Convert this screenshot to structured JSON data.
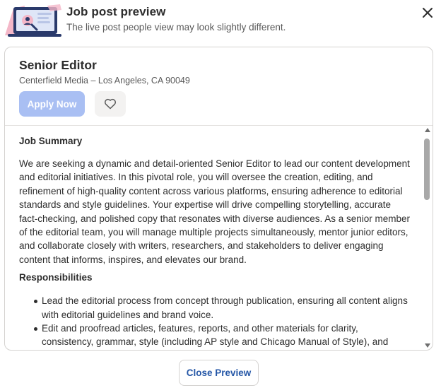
{
  "header": {
    "title": "Job post preview",
    "subtitle": "The live post people view may look slightly different."
  },
  "job": {
    "title": "Senior Editor",
    "company_location": "Centerfield Media – Los Angeles, CA 90049",
    "apply_label": "Apply Now"
  },
  "description": {
    "summary_heading": "Job Summary",
    "summary_text": "We are seeking a dynamic and detail-oriented Senior Editor to lead our content development and editorial initiatives. In this pivotal role, you will oversee the creation, editing, and refinement of high-quality content across various platforms, ensuring adherence to editorial standards and style guidelines. Your expertise will drive compelling storytelling, accurate fact-checking, and polished copy that resonates with diverse audiences. As a senior member of the editorial team, you will manage multiple projects simultaneously, mentor junior editors, and collaborate closely with writers, researchers, and stakeholders to deliver engaging content that informs, inspires, and elevates our brand.",
    "responsibilities_heading": "Responsibilities",
    "responsibilities": [
      "Lead the editorial process from concept through publication, ensuring all content aligns with editorial guidelines and brand voice.",
      "Edit and proofread articles, features, reports, and other materials for clarity, consistency, grammar, style (including AP style and Chicago Manual of Style), and"
    ]
  },
  "footer": {
    "close_preview_label": "Close Preview"
  },
  "colors": {
    "apply_disabled": "#a9bff3",
    "link_blue": "#2557a7",
    "illustration_pink": "#f4b7c8",
    "illustration_navy": "#2a3a6b"
  },
  "icons": {
    "close": "close-icon",
    "save": "heart-icon",
    "illustration": "laptop-illustration",
    "scroll_up": "scroll-up-arrow",
    "scroll_down": "scroll-down-arrow"
  }
}
